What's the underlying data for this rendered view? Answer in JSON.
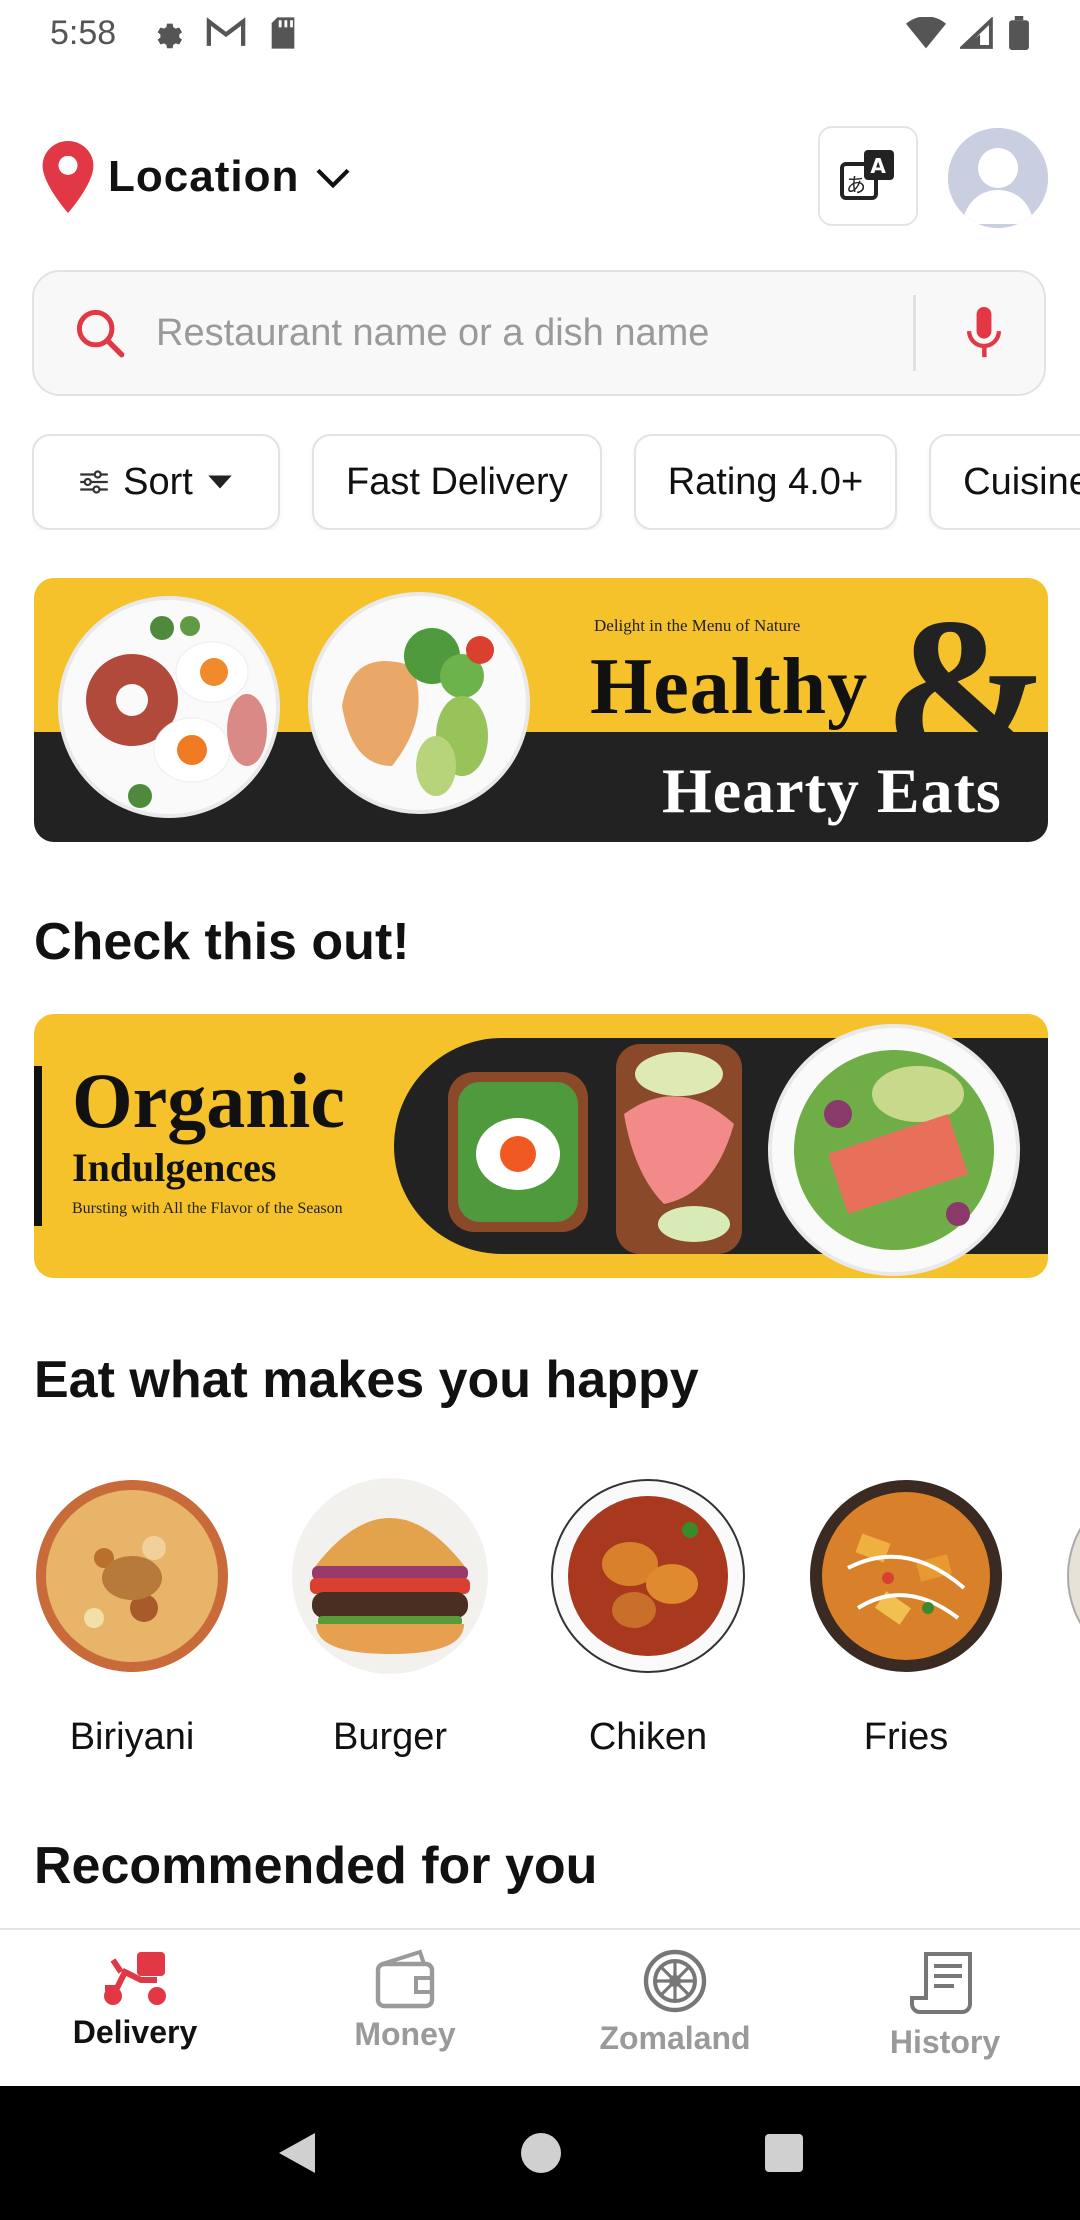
{
  "status_bar": {
    "time": "5:58",
    "icons_left": [
      "gear-icon",
      "gmail-icon",
      "sd-card-icon"
    ],
    "icons_right": [
      "wifi-icon",
      "signal-icon",
      "battery-icon"
    ]
  },
  "header": {
    "location_label": "Location",
    "icons": [
      "location-pin-icon",
      "chevron-down-icon",
      "translate-icon",
      "avatar-icon"
    ]
  },
  "search": {
    "placeholder": "Restaurant name or a dish name",
    "value": ""
  },
  "filters": {
    "sort_label": "Sort",
    "chips": [
      "Fast Delivery",
      "Rating 4.0+",
      "Cuisine"
    ]
  },
  "banner1": {
    "tagline": "Delight in the Menu of Nature",
    "title": "Healthy",
    "ampersand": "&",
    "subtitle": "Hearty Eats"
  },
  "sections": {
    "check_out": "Check this out!",
    "happy": "Eat what makes you happy",
    "recommended": "Recommended for you"
  },
  "banner2": {
    "title": "Organic",
    "subtitle": "Indulgences",
    "tagline": "Bursting with All the Flavor of the Season"
  },
  "categories": [
    {
      "label": "Biriyani"
    },
    {
      "label": "Burger"
    },
    {
      "label": "Chiken"
    },
    {
      "label": "Fries"
    }
  ],
  "bottom_nav": {
    "items": [
      {
        "label": "Delivery",
        "active": true
      },
      {
        "label": "Money",
        "active": false
      },
      {
        "label": "Zomaland",
        "active": false
      },
      {
        "label": "History",
        "active": false
      }
    ]
  },
  "colors": {
    "accent": "#e23744",
    "banner_yellow": "#f5c22c",
    "banner_dark": "#222222"
  }
}
